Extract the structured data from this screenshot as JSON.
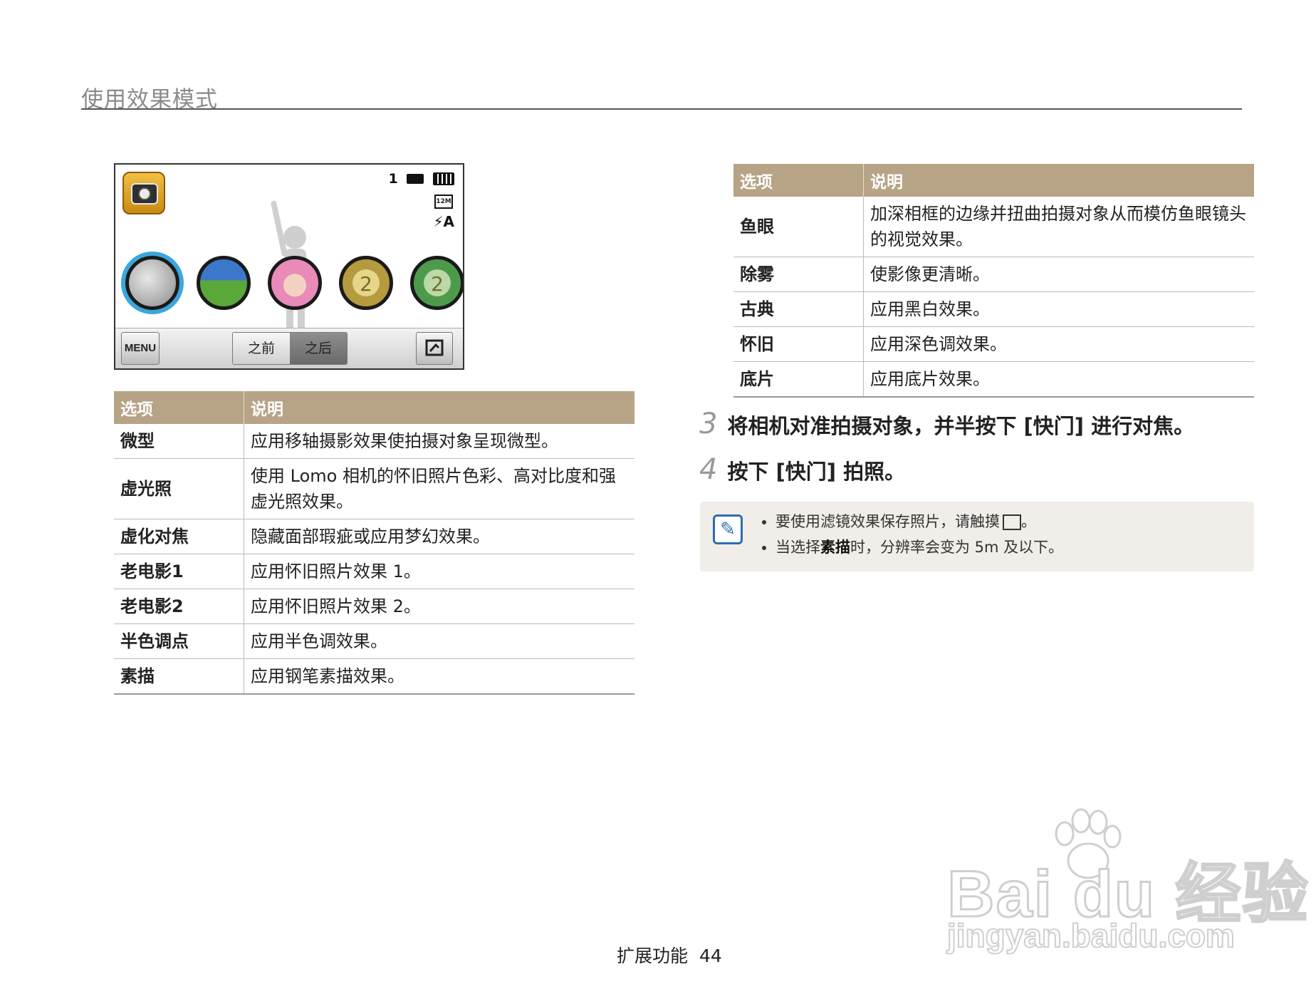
{
  "page": {
    "title": "使用效果模式"
  },
  "camera": {
    "shots_remaining": "1",
    "resolution": "12M",
    "flash": "⚡A",
    "menu_label": "MENU",
    "before_label": "之前",
    "after_label": "之后",
    "filter_numbers": [
      "2",
      "2"
    ]
  },
  "table_left": {
    "headers": [
      "选项",
      "说明"
    ],
    "rows": [
      {
        "name": "微型",
        "desc": "应用移轴摄影效果使拍摄对象呈现微型。"
      },
      {
        "name": "虚光照",
        "desc": "使用 Lomo 相机的怀旧照片色彩、高对比度和强虚光照效果。"
      },
      {
        "name": "虚化对焦",
        "desc": "隐藏面部瑕疵或应用梦幻效果。"
      },
      {
        "name": "老电影1",
        "desc": "应用怀旧照片效果 1。"
      },
      {
        "name": "老电影2",
        "desc": "应用怀旧照片效果 2。"
      },
      {
        "name": "半色调点",
        "desc": "应用半色调效果。"
      },
      {
        "name": "素描",
        "desc": "应用钢笔素描效果。"
      }
    ]
  },
  "table_right": {
    "headers": [
      "选项",
      "说明"
    ],
    "rows": [
      {
        "name": "鱼眼",
        "desc": "加深相框的边缘并扭曲拍摄对象从而模仿鱼眼镜头的视觉效果。"
      },
      {
        "name": "除雾",
        "desc": "使影像更清晰。"
      },
      {
        "name": "古典",
        "desc": "应用黑白效果。"
      },
      {
        "name": "怀旧",
        "desc": "应用深色调效果。"
      },
      {
        "name": "底片",
        "desc": "应用底片效果。"
      }
    ]
  },
  "steps": [
    {
      "num": "3",
      "text": "将相机对准拍摄对象，并半按下 [快门] 进行对焦。"
    },
    {
      "num": "4",
      "text": "按下 [快门] 拍照。"
    }
  ],
  "note": {
    "item1_text": "要使用滤镜效果保存照片，请触摸",
    "item1_end": "。",
    "item2_pre": "当选择",
    "item2_bold": "素描",
    "item2_post": "时，分辨率会变为 5m 及以下。"
  },
  "footer": {
    "section": "扩展功能",
    "page_number": "44"
  },
  "watermark": {
    "logo": "Bai du 经验",
    "url": "jingyan.baidu.com"
  },
  "colors": {
    "table_header": "#b7a386",
    "note_bg": "#f1ede8",
    "note_icon": "#2b6fb3"
  }
}
